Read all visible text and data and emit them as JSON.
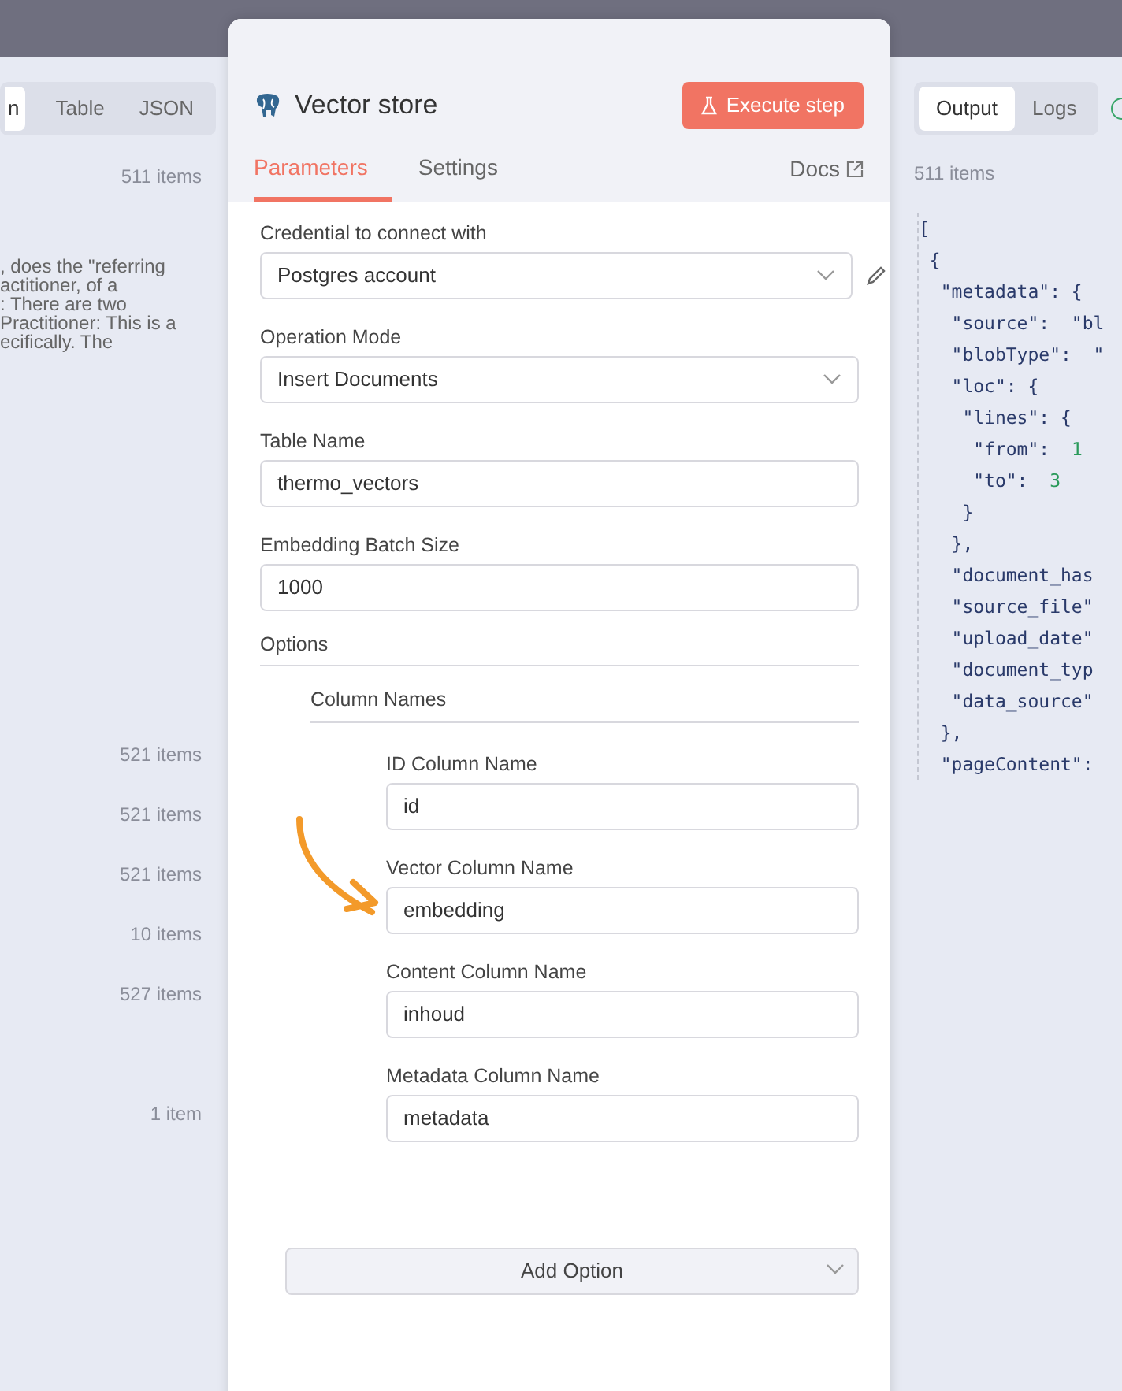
{
  "left_pane": {
    "view_tabs": [
      {
        "label": "n",
        "selected": true
      },
      {
        "label": "Table",
        "selected": false
      },
      {
        "label": "JSON",
        "selected": false
      }
    ],
    "first_count": "511 items",
    "text_lines": [
      ", does the \"referring",
      "actitioner, of a",
      ": There are two",
      "Practitioner: This is a",
      "ecifically. The"
    ],
    "item_counts": [
      "521 items",
      "521 items",
      "521 items",
      "10 items",
      "527 items",
      "1 item"
    ]
  },
  "node_panel": {
    "title": "Vector store",
    "execute_button": "Execute step",
    "tabs": [
      {
        "label": "Parameters",
        "selected": true
      },
      {
        "label": "Settings",
        "selected": false
      }
    ],
    "docs_link": "Docs",
    "fields": [
      {
        "label": "Credential to connect with",
        "kind": "select",
        "value": "Postgres account",
        "editable": true
      },
      {
        "label": "Operation Mode",
        "kind": "select",
        "value": "Insert Documents",
        "editable": false
      },
      {
        "label": "Table Name",
        "kind": "text",
        "value": "thermo_vectors",
        "editable": false
      },
      {
        "label": "Embedding Batch Size",
        "kind": "text",
        "value": "1000",
        "editable": false
      }
    ],
    "options": {
      "label": "Options",
      "group": {
        "label": "Column Names",
        "fields": [
          {
            "label": "ID Column Name",
            "value": "id"
          },
          {
            "label": "Vector Column Name",
            "value": "embedding"
          },
          {
            "label": "Content Column Name",
            "value": "inhoud"
          },
          {
            "label": "Metadata Column Name",
            "value": "metadata"
          }
        ]
      }
    },
    "add_option": "Add Option"
  },
  "output_pane": {
    "tabs": [
      {
        "label": "Output",
        "selected": true
      },
      {
        "label": "Logs",
        "selected": false
      }
    ],
    "item_count": "511 items",
    "code_lines": [
      {
        "text": "["
      },
      {
        "text": " {"
      },
      {
        "text": "  \"metadata\": {"
      },
      {
        "text": "   \"source\":  \"bl"
      },
      {
        "text": "   \"blobType\":  \""
      },
      {
        "text": "   \"loc\": {"
      },
      {
        "text": "    \"lines\": {"
      },
      {
        "text": "     \"from\":  ",
        "number": "1"
      },
      {
        "text": "     \"to\":  ",
        "number": "3"
      },
      {
        "text": "    }"
      },
      {
        "text": "   },"
      },
      {
        "text": "   \"document_has"
      },
      {
        "text": "   \"source_file\""
      },
      {
        "text": "   \"upload_date\""
      },
      {
        "text": "   \"document_typ"
      },
      {
        "text": "   \"data_source\""
      },
      {
        "text": "  },"
      },
      {
        "text": "  \"pageContent\":"
      }
    ]
  }
}
